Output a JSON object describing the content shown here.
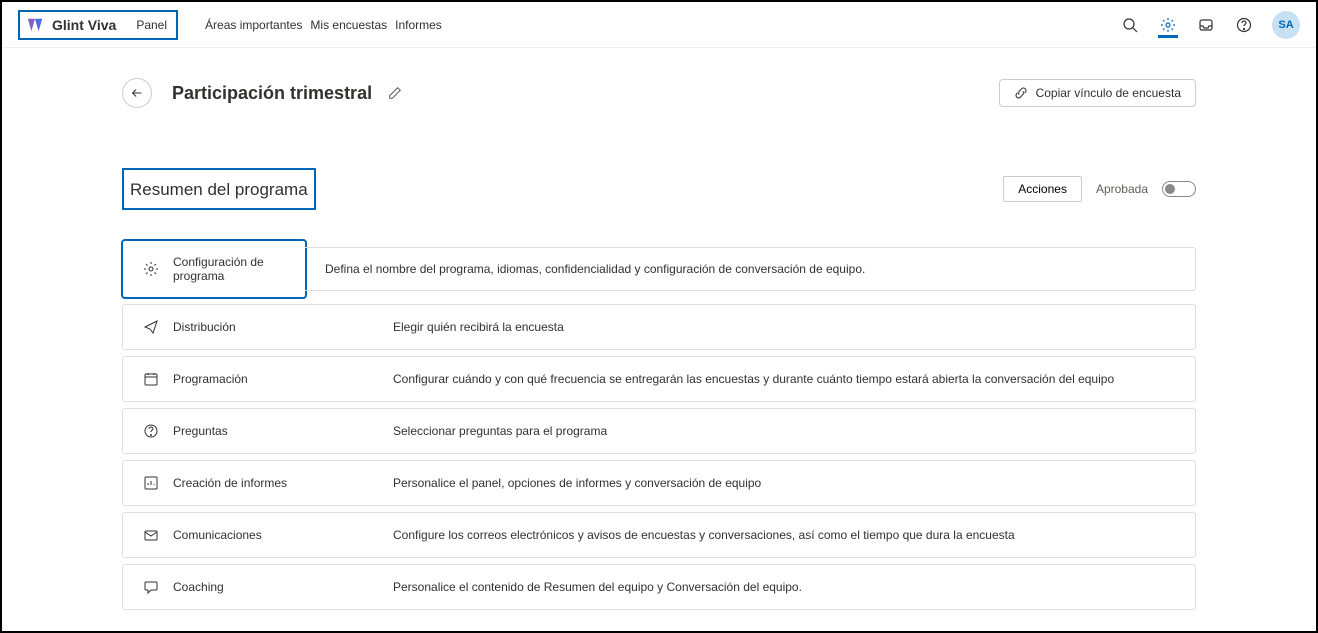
{
  "brand": "Glint Viva",
  "nav": {
    "panel": "Panel",
    "areas": "Áreas importantes",
    "surveys": "Mis encuestas",
    "reports": "Informes"
  },
  "avatar": "SA",
  "page": {
    "title": "Participación trimestral",
    "copy_link": "Copiar vínculo de encuesta"
  },
  "summary": {
    "title": "Resumen del programa",
    "actions": "Acciones",
    "approved": "Aprobada"
  },
  "cards": [
    {
      "label": "Configuración de programa",
      "desc": "Defina el nombre del programa, idiomas, confidencialidad y configuración de conversación de equipo."
    },
    {
      "label": "Distribución",
      "desc": "Elegir quién recibirá la encuesta"
    },
    {
      "label": "Programación",
      "desc": "Configurar cuándo y con qué frecuencia se entregarán las encuestas y durante cuánto tiempo estará abierta la conversación del equipo"
    },
    {
      "label": "Preguntas",
      "desc": "Seleccionar preguntas para el programa"
    },
    {
      "label": "Creación de informes",
      "desc": "Personalice el panel, opciones de informes y conversación de equipo"
    },
    {
      "label": "Comunicaciones",
      "desc": "Configure los correos electrónicos y avisos de encuestas y conversaciones, así como el tiempo que dura la encuesta"
    },
    {
      "label": "Coaching",
      "desc": "Personalice el contenido de Resumen del equipo y Conversación del equipo."
    }
  ]
}
